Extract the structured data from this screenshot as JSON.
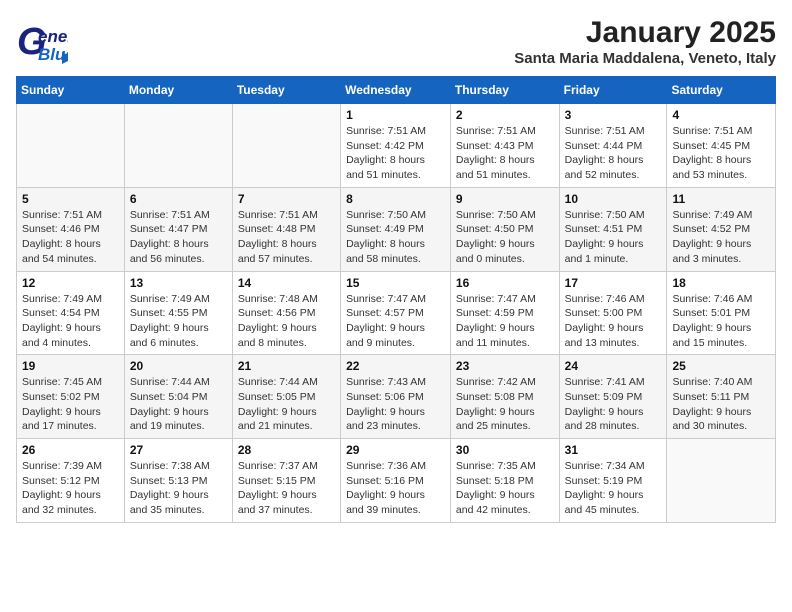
{
  "header": {
    "logo_general": "General",
    "logo_blue": "Blue",
    "title": "January 2025",
    "subtitle": "Santa Maria Maddalena, Veneto, Italy"
  },
  "days_of_week": [
    "Sunday",
    "Monday",
    "Tuesday",
    "Wednesday",
    "Thursday",
    "Friday",
    "Saturday"
  ],
  "weeks": [
    [
      {
        "num": "",
        "info": ""
      },
      {
        "num": "",
        "info": ""
      },
      {
        "num": "",
        "info": ""
      },
      {
        "num": "1",
        "info": "Sunrise: 7:51 AM\nSunset: 4:42 PM\nDaylight: 8 hours and 51 minutes."
      },
      {
        "num": "2",
        "info": "Sunrise: 7:51 AM\nSunset: 4:43 PM\nDaylight: 8 hours and 51 minutes."
      },
      {
        "num": "3",
        "info": "Sunrise: 7:51 AM\nSunset: 4:44 PM\nDaylight: 8 hours and 52 minutes."
      },
      {
        "num": "4",
        "info": "Sunrise: 7:51 AM\nSunset: 4:45 PM\nDaylight: 8 hours and 53 minutes."
      }
    ],
    [
      {
        "num": "5",
        "info": "Sunrise: 7:51 AM\nSunset: 4:46 PM\nDaylight: 8 hours and 54 minutes."
      },
      {
        "num": "6",
        "info": "Sunrise: 7:51 AM\nSunset: 4:47 PM\nDaylight: 8 hours and 56 minutes."
      },
      {
        "num": "7",
        "info": "Sunrise: 7:51 AM\nSunset: 4:48 PM\nDaylight: 8 hours and 57 minutes."
      },
      {
        "num": "8",
        "info": "Sunrise: 7:50 AM\nSunset: 4:49 PM\nDaylight: 8 hours and 58 minutes."
      },
      {
        "num": "9",
        "info": "Sunrise: 7:50 AM\nSunset: 4:50 PM\nDaylight: 9 hours and 0 minutes."
      },
      {
        "num": "10",
        "info": "Sunrise: 7:50 AM\nSunset: 4:51 PM\nDaylight: 9 hours and 1 minute."
      },
      {
        "num": "11",
        "info": "Sunrise: 7:49 AM\nSunset: 4:52 PM\nDaylight: 9 hours and 3 minutes."
      }
    ],
    [
      {
        "num": "12",
        "info": "Sunrise: 7:49 AM\nSunset: 4:54 PM\nDaylight: 9 hours and 4 minutes."
      },
      {
        "num": "13",
        "info": "Sunrise: 7:49 AM\nSunset: 4:55 PM\nDaylight: 9 hours and 6 minutes."
      },
      {
        "num": "14",
        "info": "Sunrise: 7:48 AM\nSunset: 4:56 PM\nDaylight: 9 hours and 8 minutes."
      },
      {
        "num": "15",
        "info": "Sunrise: 7:47 AM\nSunset: 4:57 PM\nDaylight: 9 hours and 9 minutes."
      },
      {
        "num": "16",
        "info": "Sunrise: 7:47 AM\nSunset: 4:59 PM\nDaylight: 9 hours and 11 minutes."
      },
      {
        "num": "17",
        "info": "Sunrise: 7:46 AM\nSunset: 5:00 PM\nDaylight: 9 hours and 13 minutes."
      },
      {
        "num": "18",
        "info": "Sunrise: 7:46 AM\nSunset: 5:01 PM\nDaylight: 9 hours and 15 minutes."
      }
    ],
    [
      {
        "num": "19",
        "info": "Sunrise: 7:45 AM\nSunset: 5:02 PM\nDaylight: 9 hours and 17 minutes."
      },
      {
        "num": "20",
        "info": "Sunrise: 7:44 AM\nSunset: 5:04 PM\nDaylight: 9 hours and 19 minutes."
      },
      {
        "num": "21",
        "info": "Sunrise: 7:44 AM\nSunset: 5:05 PM\nDaylight: 9 hours and 21 minutes."
      },
      {
        "num": "22",
        "info": "Sunrise: 7:43 AM\nSunset: 5:06 PM\nDaylight: 9 hours and 23 minutes."
      },
      {
        "num": "23",
        "info": "Sunrise: 7:42 AM\nSunset: 5:08 PM\nDaylight: 9 hours and 25 minutes."
      },
      {
        "num": "24",
        "info": "Sunrise: 7:41 AM\nSunset: 5:09 PM\nDaylight: 9 hours and 28 minutes."
      },
      {
        "num": "25",
        "info": "Sunrise: 7:40 AM\nSunset: 5:11 PM\nDaylight: 9 hours and 30 minutes."
      }
    ],
    [
      {
        "num": "26",
        "info": "Sunrise: 7:39 AM\nSunset: 5:12 PM\nDaylight: 9 hours and 32 minutes."
      },
      {
        "num": "27",
        "info": "Sunrise: 7:38 AM\nSunset: 5:13 PM\nDaylight: 9 hours and 35 minutes."
      },
      {
        "num": "28",
        "info": "Sunrise: 7:37 AM\nSunset: 5:15 PM\nDaylight: 9 hours and 37 minutes."
      },
      {
        "num": "29",
        "info": "Sunrise: 7:36 AM\nSunset: 5:16 PM\nDaylight: 9 hours and 39 minutes."
      },
      {
        "num": "30",
        "info": "Sunrise: 7:35 AM\nSunset: 5:18 PM\nDaylight: 9 hours and 42 minutes."
      },
      {
        "num": "31",
        "info": "Sunrise: 7:34 AM\nSunset: 5:19 PM\nDaylight: 9 hours and 45 minutes."
      },
      {
        "num": "",
        "info": ""
      }
    ]
  ]
}
